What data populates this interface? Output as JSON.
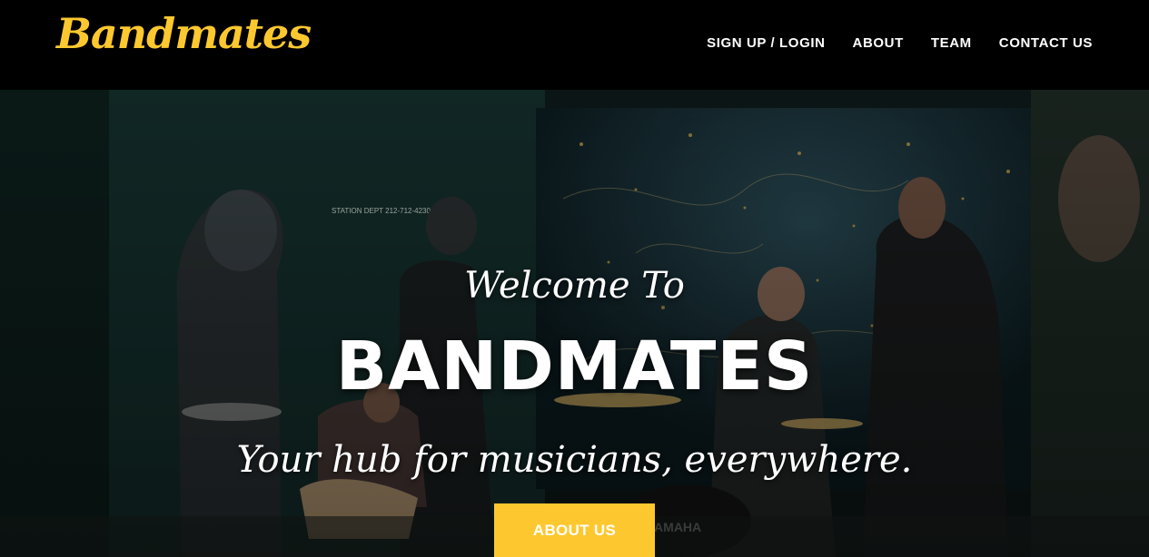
{
  "brand": {
    "logo_text": "Bandmates",
    "logo_color": "#fdc82f"
  },
  "nav": {
    "items": [
      {
        "label": "SIGN UP / LOGIN"
      },
      {
        "label": "ABOUT"
      },
      {
        "label": "TEAM"
      },
      {
        "label": "CONTACT US"
      }
    ]
  },
  "hero": {
    "welcome": "Welcome To",
    "title": "BANDMATES",
    "tagline": "Your hub for musicians, everywhere.",
    "button_label": "ABOUT US",
    "button_color": "#fdc82f",
    "background_image": "band-rehearsal-photo",
    "photo_text": {
      "sign": "STATION DEPT 212-712-4230",
      "drum_brand": "YAMAHA"
    }
  }
}
